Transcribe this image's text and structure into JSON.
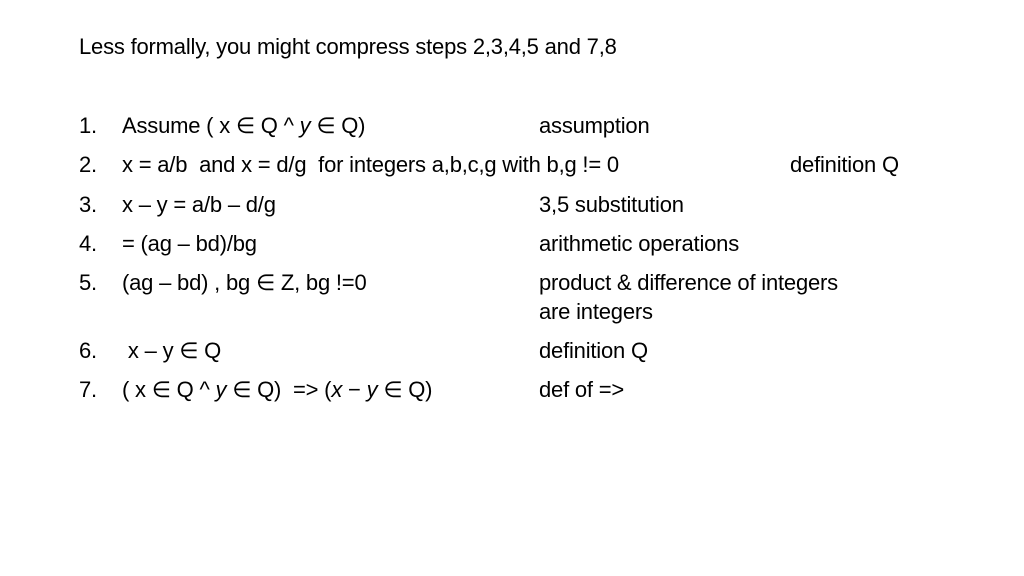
{
  "slide": {
    "heading": "Less formally, you might compress steps 2,3,4,5 and 7,8",
    "steps": [
      {
        "number": "1.",
        "statement_parts": [
          "Assume ( x ∈ Q ^ ",
          "y",
          " ∈ Q)"
        ],
        "justification": "assumption"
      },
      {
        "number": "2.",
        "statement": "x = a/b  and x = d/g  for integers a,b,c,g with b,g != 0",
        "justification": "definition Q"
      },
      {
        "number": "3.",
        "statement": "x – y = a/b – d/g",
        "justification": "3,5 substitution"
      },
      {
        "number": "4.",
        "statement": "= (ag – bd)/bg",
        "justification": "arithmetic operations"
      },
      {
        "number": "5.",
        "statement": "(ag – bd) , bg ∈ Z, bg !=0",
        "justification_lines": [
          "product & difference of integers",
          "are integers"
        ]
      },
      {
        "number": "6.",
        "statement": " x – y ∈ Q",
        "justification": "definition Q"
      },
      {
        "number": "7.",
        "statement_parts": [
          "( x ∈ Q ^ ",
          "y",
          " ∈ Q)  => (",
          "x",
          " − ",
          "y",
          " ∈ Q)"
        ],
        "justification": "def of =>"
      }
    ]
  }
}
